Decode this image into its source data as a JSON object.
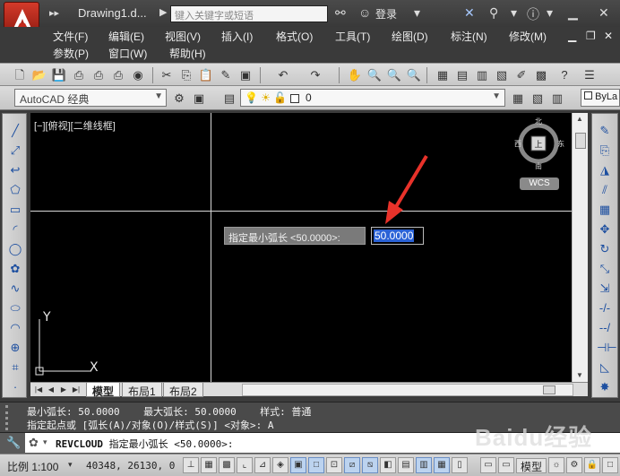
{
  "titlebar": {
    "doc_title": "Drawing1.d...",
    "search_placeholder": "键入关键字或短语",
    "login": "登录"
  },
  "menus": {
    "row1": [
      "文件(F)",
      "编辑(E)",
      "视图(V)",
      "插入(I)",
      "格式(O)",
      "工具(T)",
      "绘图(D)",
      "标注(N)",
      "修改(M)"
    ],
    "row2": [
      "参数(P)",
      "窗口(W)",
      "帮助(H)"
    ]
  },
  "workspace": {
    "selected": "AutoCAD 经典"
  },
  "layer": {
    "selected": "0"
  },
  "properties": {
    "color": "ByLa"
  },
  "viewport": {
    "label": "[−][俯视][二维线框]",
    "dynamic_prompt": "指定最小弧长 <50.0000>:",
    "dynamic_value": "50.0000",
    "ucs_x": "X",
    "ucs_y": "Y"
  },
  "viewcube": {
    "north": "北",
    "south": "南",
    "east": "东",
    "west": "西",
    "top": "上",
    "wcs": "WCS"
  },
  "layout_tabs": [
    "模型",
    "布局1",
    "布局2"
  ],
  "command": {
    "history_line1": "最小弧长: 50.0000    最大弧长: 50.0000    样式: 普通",
    "history_line2": "指定起点或 [弧长(A)/对象(O)/样式(S)] <对象>: A",
    "current_cmd": "REVCLOUD",
    "current_prompt": " 指定最小弧长 <50.0000>:"
  },
  "status": {
    "scale": "比例 1:100",
    "coords": "40348, 26130, 0",
    "model": "模型"
  },
  "watermark": "Baidu经验"
}
